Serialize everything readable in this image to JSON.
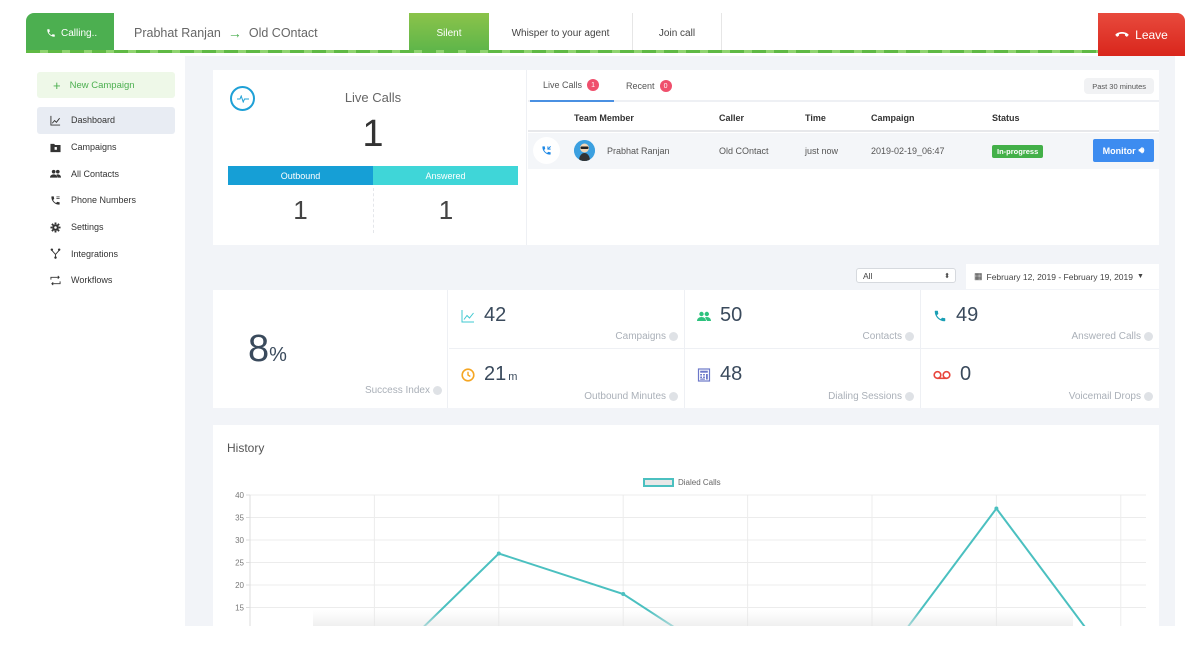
{
  "callbar": {
    "status_label": "Calling..",
    "from": "Prabhat Ranjan",
    "to": "Old COntact",
    "silent_label": "Silent",
    "whisper_label": "Whisper to your agent",
    "join_label": "Join call",
    "leave_label": "Leave"
  },
  "sidebar": {
    "new_campaign_label": "New Campaign",
    "items": [
      {
        "label": "Dashboard",
        "icon": "chart-line-icon",
        "active": true
      },
      {
        "label": "Campaigns",
        "icon": "folder-icon"
      },
      {
        "label": "All Contacts",
        "icon": "users-icon"
      },
      {
        "label": "Phone Numbers",
        "icon": "phone-icon"
      },
      {
        "label": "Settings",
        "icon": "gear-icon"
      },
      {
        "label": "Integrations",
        "icon": "fork-icon"
      },
      {
        "label": "Workflows",
        "icon": "workflow-icon"
      }
    ]
  },
  "live": {
    "title": "Live Calls",
    "count": "1",
    "outbound_label": "Outbound",
    "answered_label": "Answered",
    "outbound_value": "1",
    "answered_value": "1"
  },
  "live_table": {
    "tabs": [
      {
        "label": "Live Calls",
        "badge": "1",
        "active": true
      },
      {
        "label": "Recent",
        "badge": "0"
      }
    ],
    "timeframe": "Past 30 minutes",
    "columns": [
      "Team Member",
      "Caller",
      "Time",
      "Campaign",
      "Status"
    ],
    "rows": [
      {
        "team_member": "Prabhat Ranjan",
        "caller": "Old COntact",
        "time": "just now",
        "campaign": "2019-02-19_06:47",
        "status": "In-progress",
        "action": "Monitor"
      }
    ]
  },
  "filters": {
    "select_value": "All",
    "date_range": "February 12, 2019 - February 19, 2019"
  },
  "stats": {
    "success_index": {
      "value": "8",
      "unit": "%",
      "label": "Success Index"
    },
    "cells": [
      {
        "value": "42",
        "unit": "",
        "label": "Campaigns",
        "icon": "chart-line-icon",
        "color": "#3fc8d0"
      },
      {
        "value": "50",
        "unit": "",
        "label": "Contacts",
        "icon": "users-icon",
        "color": "#2ec27e"
      },
      {
        "value": "49",
        "unit": "",
        "label": "Answered Calls",
        "icon": "phone-icon",
        "color": "#1a9fb5"
      },
      {
        "value": "21",
        "unit": "m",
        "label": "Outbound Minutes",
        "icon": "clock-icon",
        "color": "#f5a623"
      },
      {
        "value": "48",
        "unit": "",
        "label": "Dialing Sessions",
        "icon": "calculator-icon",
        "color": "#6c78c9"
      },
      {
        "value": "0",
        "unit": "",
        "label": "Voicemail Drops",
        "icon": "voicemail-icon",
        "color": "#e8453c"
      }
    ]
  },
  "history": {
    "title": "History"
  },
  "chart_data": {
    "type": "line",
    "title": "History",
    "xlabel": "",
    "ylabel": "",
    "ylim": [
      0,
      40
    ],
    "yticks": [
      5,
      10,
      15,
      20,
      25,
      30,
      35,
      40
    ],
    "grid": true,
    "legend_position": "top-center",
    "series": [
      {
        "name": "Dialed Calls",
        "color": "#4bc0c0",
        "values": [
          0,
          27,
          18,
          0,
          0,
          37,
          0
        ]
      }
    ],
    "x_index": [
      1,
      2,
      3,
      4,
      5,
      6,
      7
    ]
  },
  "colors": {
    "accent_green": "#4caf50",
    "leave_red": "#e2382c",
    "outbound_blue": "#169fd6",
    "answered_cyan": "#3fd6d8",
    "monitor_blue": "#3d8cf0",
    "status_green": "#43b049",
    "line_teal": "#4bc0c0"
  }
}
